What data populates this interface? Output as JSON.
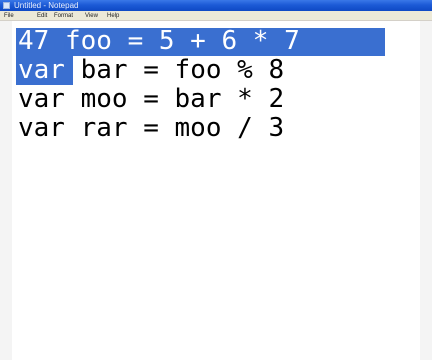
{
  "window": {
    "title": "Untitled - Notepad"
  },
  "menu": {
    "file": "File",
    "edit": "Edit",
    "format": "Format",
    "view": "View",
    "help": "Help"
  },
  "editor": {
    "line1": "47 foo = 5 + 6 * 7",
    "line2_selected": "var",
    "line2_rest": " bar = foo % 8",
    "line3": "var moo = bar * 2",
    "line4": "var rar = moo / 3"
  },
  "colors": {
    "selection": "#3a6fd0",
    "titlebar": "#1c5ad6"
  }
}
